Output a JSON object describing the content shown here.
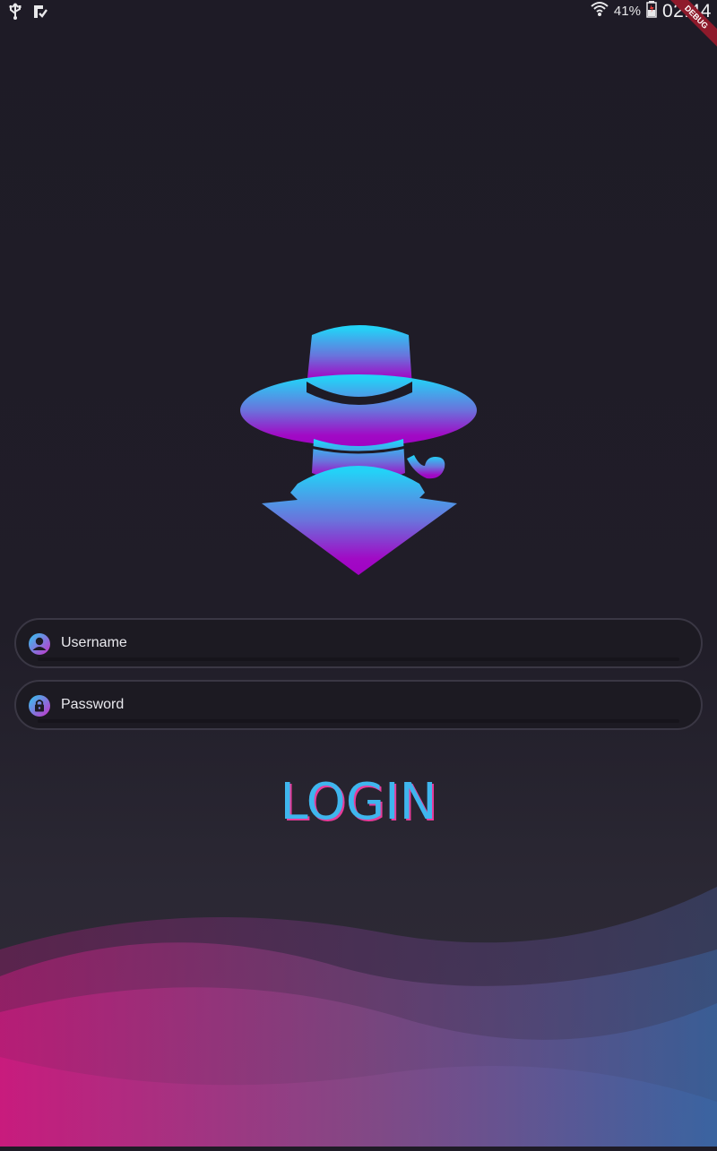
{
  "status_bar": {
    "left_icons": [
      "usb-icon",
      "app-notification-icon"
    ],
    "right_icons": [
      "wifi-icon",
      "battery-icon"
    ],
    "battery_percent": "41%",
    "time": "02:44"
  },
  "debug_banner": {
    "text": "DEBUG"
  },
  "logo": {
    "icon": "spy-hat-logo-icon",
    "gradient": [
      "#23d2f7",
      "#a102c4"
    ]
  },
  "form": {
    "username": {
      "placeholder": "Username",
      "value": "",
      "icon": "user-icon"
    },
    "password": {
      "placeholder": "Password",
      "value": "",
      "icon": "lock-icon"
    }
  },
  "login_button": {
    "label": "LOGIN"
  },
  "colors": {
    "accent_blue": "#3fb6ee",
    "accent_pink": "#e63c9a",
    "background": "#201d28"
  }
}
